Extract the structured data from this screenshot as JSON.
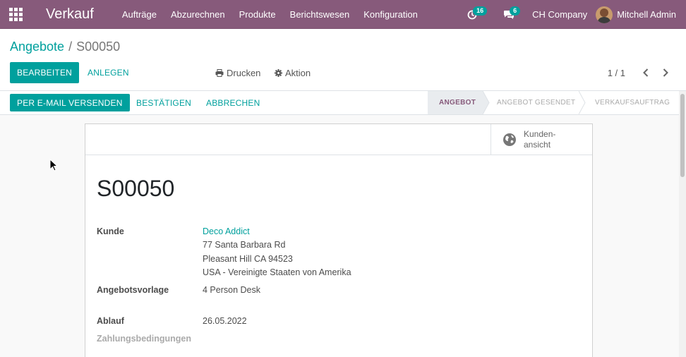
{
  "navbar": {
    "app_name": "Verkauf",
    "menu": [
      "Aufträge",
      "Abzurechnen",
      "Produkte",
      "Berichtswesen",
      "Konfiguration"
    ],
    "activity_count": "16",
    "messages_count": "6",
    "company": "CH Company",
    "user_name": "Mitchell Admin"
  },
  "breadcrumb": {
    "parent": "Angebote",
    "separator": "/",
    "current": "S00050"
  },
  "control_panel": {
    "edit_label": "BEARBEITEN",
    "create_label": "ANLEGEN",
    "print_label": "Drucken",
    "action_label": "Aktion",
    "pager": "1 / 1"
  },
  "statusbar": {
    "send_email_label": "PER E-MAIL VERSENDEN",
    "confirm_label": "BESTÄTIGEN",
    "cancel_label": "ABBRECHEN",
    "stages": [
      "ANGEBOT",
      "ANGEBOT GESENDET",
      "VERKAUFSAUFTRAG"
    ],
    "active_stage": "ANGEBOT"
  },
  "sheet": {
    "stat_button_line1": "Kunden-",
    "stat_button_line2": "ansicht",
    "name": "S00050",
    "customer_label": "Kunde",
    "customer_name": "Deco Addict",
    "address_line1": "77 Santa Barbara Rd",
    "address_line2": "Pleasant Hill CA 94523",
    "address_line3": "USA - Vereinigte Staaten von Amerika",
    "template_label": "Angebotsvorlage",
    "template_value": "4 Person Desk",
    "expiry_label": "Ablauf",
    "expiry_value": "26.05.2022",
    "payment_terms_label": "Zahlungsbedingungen"
  },
  "colors": {
    "navbar": "#875a7b",
    "primary": "#00a09d"
  }
}
